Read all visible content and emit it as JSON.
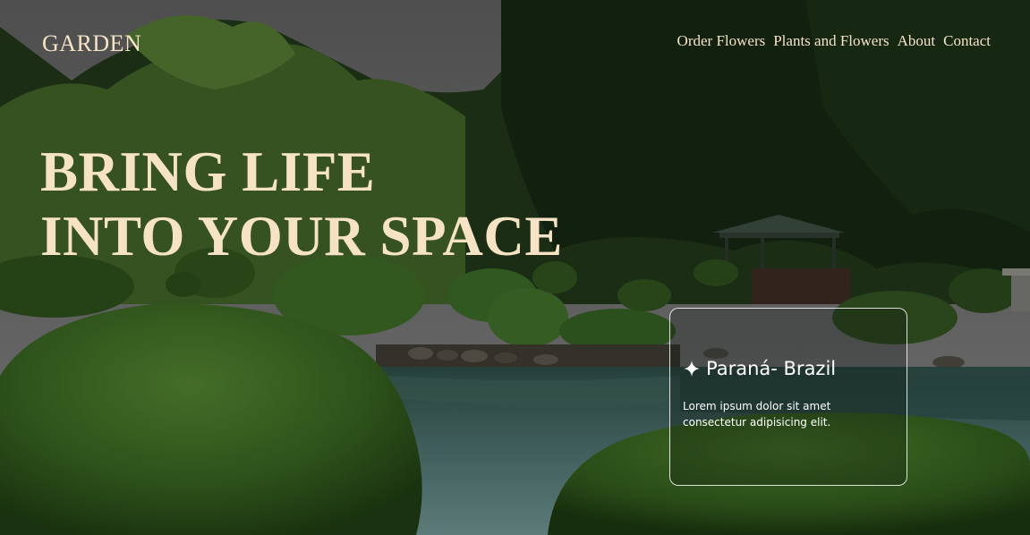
{
  "header": {
    "logo": "GARDEN",
    "nav": [
      "Order Flowers",
      "Plants and Flowers",
      "About",
      "Contact"
    ]
  },
  "hero": {
    "headline_line1": "BRING LIFE",
    "headline_line2": "INTO YOUR SPACE"
  },
  "location_card": {
    "icon": "sparkle-icon",
    "title": "Paraná- Brazil",
    "text": "Lorem ipsum dolor sit amet consectetur adipisicing elit."
  },
  "colors": {
    "text_cream": "#f6e3c6",
    "card_border": "#ffffff"
  }
}
